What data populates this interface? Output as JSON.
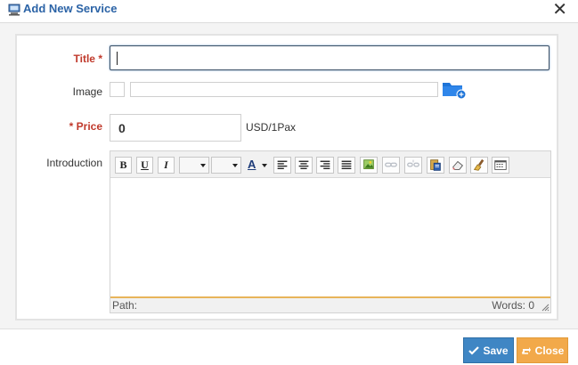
{
  "dialog": {
    "title": "Add New Service",
    "close_glyph": "✕",
    "icon": "monitor-icon"
  },
  "form": {
    "title_label": "Title",
    "title_value": "",
    "image_label": "Image",
    "image_value": "",
    "price_label": "Price",
    "price_value": "0",
    "price_unit": "USD/1Pax",
    "intro_label": "Introduction",
    "required_mark": "*"
  },
  "editor": {
    "toolbar": [
      {
        "name": "bold-button",
        "text": "B"
      },
      {
        "name": "underline-button",
        "text": "U"
      },
      {
        "name": "italic-button",
        "text": "I"
      },
      {
        "name": "font-family-select",
        "text": ""
      },
      {
        "name": "font-size-select",
        "text": ""
      },
      {
        "name": "font-color-button",
        "text": "A"
      },
      {
        "name": "align-left-icon",
        "text": ""
      },
      {
        "name": "align-center-icon",
        "text": ""
      },
      {
        "name": "align-right-icon",
        "text": ""
      },
      {
        "name": "align-justify-icon",
        "text": ""
      },
      {
        "name": "insert-image-icon",
        "text": ""
      },
      {
        "name": "link-icon",
        "text": ""
      },
      {
        "name": "unlink-icon",
        "text": ""
      },
      {
        "name": "paste-word-icon",
        "text": ""
      },
      {
        "name": "eraser-icon",
        "text": ""
      },
      {
        "name": "cleanup-brush-icon",
        "text": ""
      },
      {
        "name": "source-html-icon",
        "text": ""
      }
    ],
    "path_label": "Path:",
    "words_label": "Words: 0"
  },
  "footer": {
    "save_label": "Save",
    "close_label": "Close"
  },
  "colors": {
    "title_blue": "#2b63a6",
    "required_red": "#c0392b",
    "save_blue": "#3f86c4",
    "close_orange": "#f2a94a",
    "status_accent": "#e8b45a"
  }
}
